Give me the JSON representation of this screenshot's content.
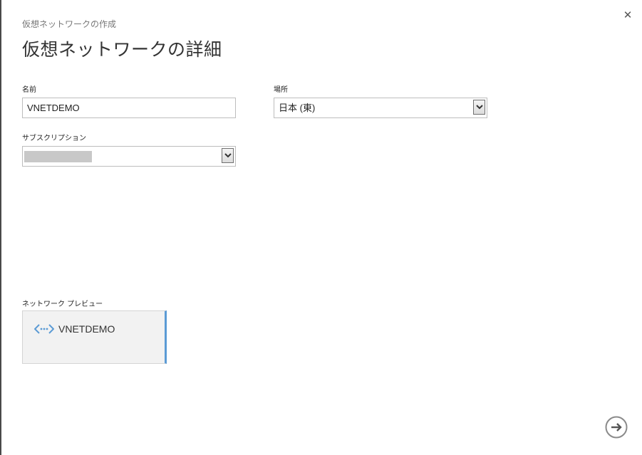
{
  "dialog": {
    "breadcrumb": "仮想ネットワークの作成",
    "title": "仮想ネットワークの詳細",
    "close_icon": "close-icon"
  },
  "form": {
    "name": {
      "label": "名前",
      "value": "VNETDEMO"
    },
    "location": {
      "label": "場所",
      "selected": "日本 (東)"
    },
    "subscription": {
      "label": "サブスクリプション",
      "selected": ""
    }
  },
  "preview": {
    "label": "ネットワーク プレビュー",
    "network_name": "VNETDEMO",
    "icon": "virtual-network-icon",
    "accent_color": "#5b9bd5"
  },
  "footer": {
    "next_icon": "arrow-right-circle-icon"
  }
}
